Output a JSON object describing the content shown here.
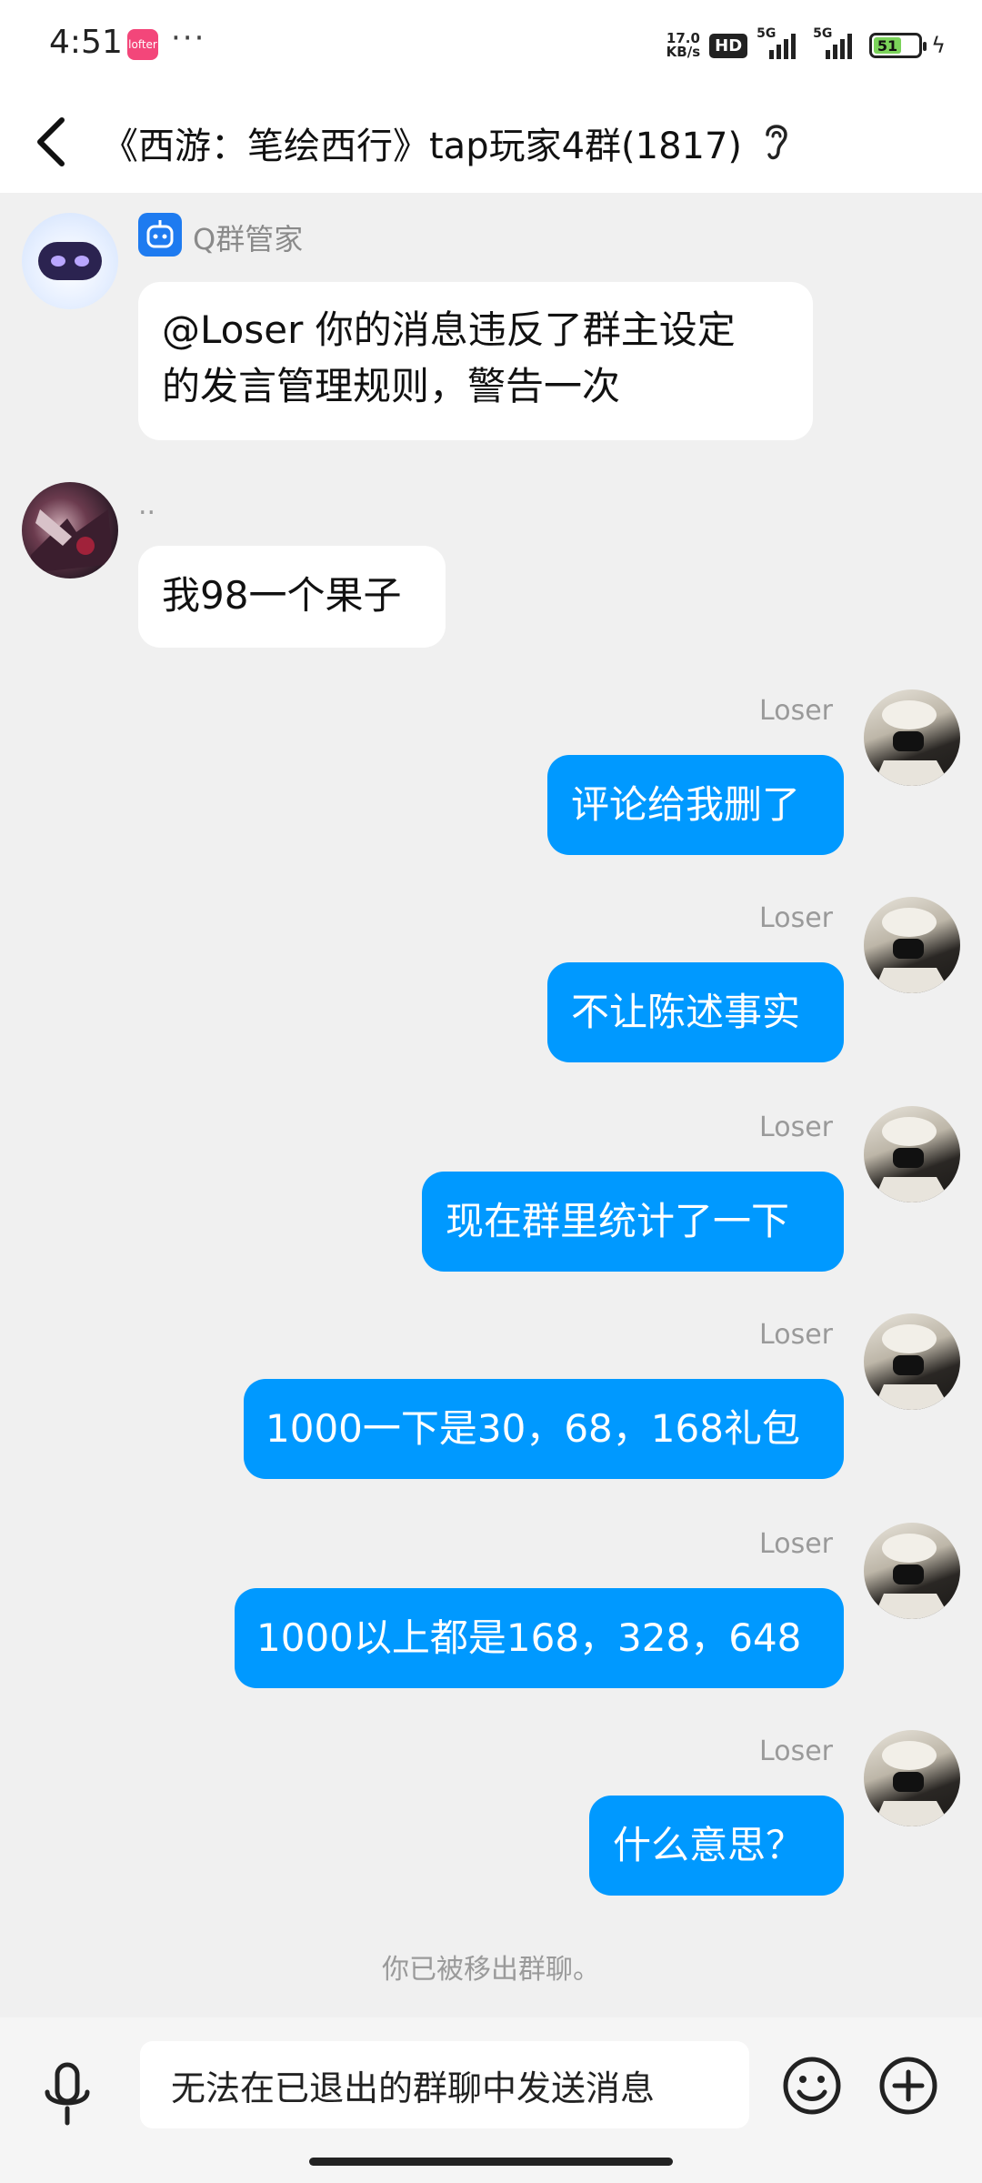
{
  "status_bar": {
    "time": "4:51",
    "app_icon_label": "lofter",
    "more_dots": "···",
    "net_speed_value": "17.0",
    "net_speed_unit": "KB/s",
    "hd_badge": "HD",
    "signal_1": "5G",
    "signal_2": "5G",
    "battery_level": "51"
  },
  "header": {
    "title": "《西游：笔绘西行》tap玩家4群(1817)",
    "back_icon": "chevron-left-icon",
    "ear_icon": "ear-icon"
  },
  "messages": [
    {
      "side": "left",
      "sender": "Q群管家",
      "text_line1": "@Loser 你的消息违反了群主设定",
      "text_line2": "的发言管理规则，警告一次"
    },
    {
      "side": "left",
      "sender": "..",
      "text": "我98一个果子"
    },
    {
      "side": "right",
      "sender": "Loser",
      "text": "评论给我删了"
    },
    {
      "side": "right",
      "sender": "Loser",
      "text": "不让陈述事实"
    },
    {
      "side": "right",
      "sender": "Loser",
      "text": "现在群里统计了一下"
    },
    {
      "side": "right",
      "sender": "Loser",
      "text": "1000一下是30，68，168礼包"
    },
    {
      "side": "right",
      "sender": "Loser",
      "text": "1000以上都是168，328，648"
    },
    {
      "side": "right",
      "sender": "Loser",
      "text": "什么意思？"
    }
  ],
  "system_notice": "你已被移出群聊。",
  "input_bar": {
    "placeholder": "无法在已退出的群聊中发送消息",
    "mic_icon": "microphone-icon",
    "emoji_icon": "smiley-icon",
    "plus_icon": "plus-circle-icon"
  },
  "colors": {
    "bubble_self": "#0099ff",
    "bubble_other": "#ffffff",
    "background": "#f0f0f0"
  }
}
